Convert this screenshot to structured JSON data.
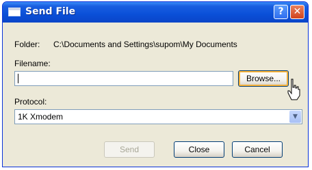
{
  "window": {
    "title": "Send File",
    "help_label": "?",
    "close_label": "✕"
  },
  "folder": {
    "label": "Folder:",
    "path": "C:\\Documents and Settings\\supom\\My Documents"
  },
  "filename": {
    "label": "Filename:",
    "value": "",
    "browse_label": "Browse..."
  },
  "protocol": {
    "label": "Protocol:",
    "selected": "1K Xmodem",
    "arrow_icon": "▼"
  },
  "buttons": {
    "send_label": "Send",
    "close_label": "Close",
    "cancel_label": "Cancel"
  },
  "colors": {
    "titlebar": "#0a4fd8",
    "dialog_bg": "#ece9d8",
    "close_button": "#d2431c"
  }
}
